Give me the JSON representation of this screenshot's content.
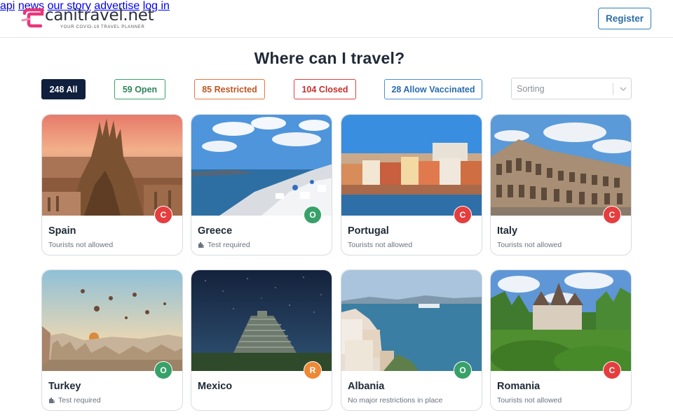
{
  "header": {
    "logo_name": "canitravel.net",
    "logo_tagline": "YOUR COVID-19 TRAVEL PLANNER",
    "brand_color": "#e9367a",
    "nav": [
      "api",
      "news",
      "our story",
      "advertise",
      "log in"
    ],
    "register_label": "Register"
  },
  "page_title": "Where can I travel?",
  "filters": {
    "all": "248 All",
    "open": "59 Open",
    "restricted": "85 Restricted",
    "closed": "104 Closed",
    "vaccinated": "28 Allow Vaccinated"
  },
  "sorting": {
    "placeholder": "Sorting"
  },
  "status_colors": {
    "closed": "#e53e3e",
    "open": "#38a169",
    "restricted": "#ed8936"
  },
  "countries": [
    {
      "name": "Spain",
      "note": "Tourists not allowed",
      "badge": "C",
      "icon": ""
    },
    {
      "name": "Greece",
      "note": "Test required",
      "badge": "O",
      "icon": "test-icon"
    },
    {
      "name": "Portugal",
      "note": "Tourists not allowed",
      "badge": "C",
      "icon": ""
    },
    {
      "name": "Italy",
      "note": "Tourists not allowed",
      "badge": "C",
      "icon": ""
    },
    {
      "name": "Turkey",
      "note": "Test required",
      "badge": "O",
      "icon": "test-icon"
    },
    {
      "name": "Mexico",
      "note": "",
      "badge": "R",
      "icon": ""
    },
    {
      "name": "Albania",
      "note": "No major restrictions in place",
      "badge": "O",
      "icon": ""
    },
    {
      "name": "Romania",
      "note": "Tourists not allowed",
      "badge": "C",
      "icon": ""
    }
  ]
}
